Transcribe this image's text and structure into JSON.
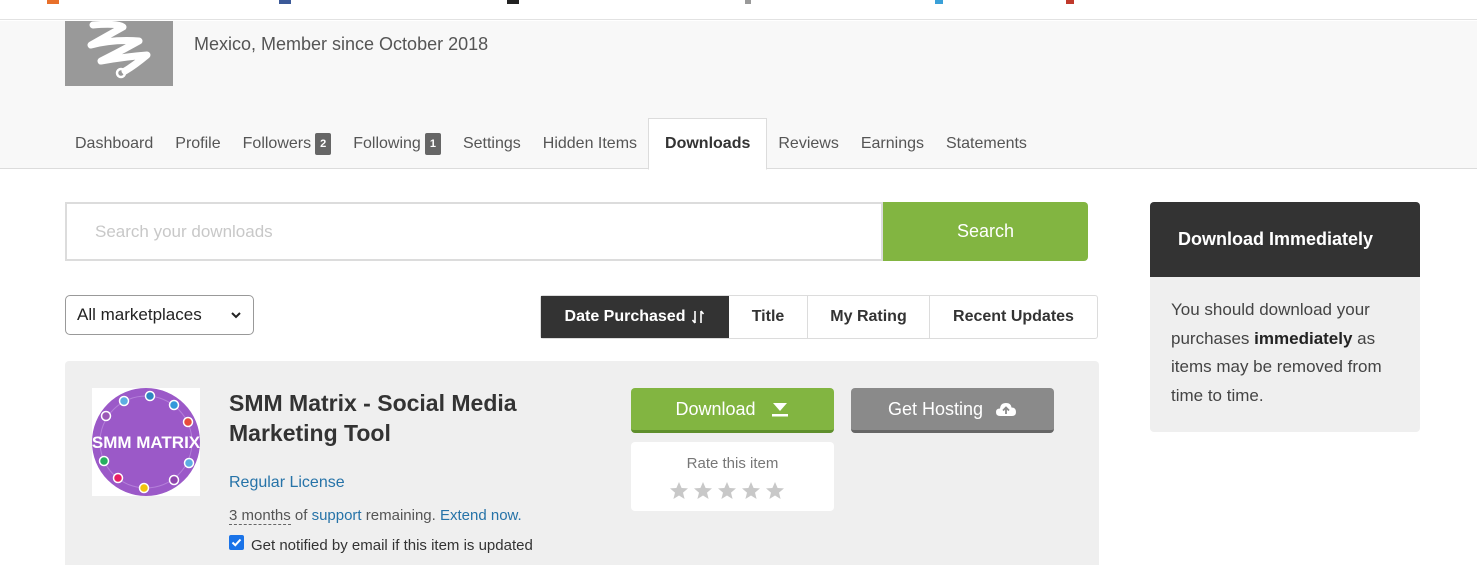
{
  "profile": {
    "location_line": "Mexico, Member since October 2018"
  },
  "tabs": [
    {
      "label": "Dashboard"
    },
    {
      "label": "Profile"
    },
    {
      "label": "Followers",
      "badge": "2"
    },
    {
      "label": "Following",
      "badge": "1"
    },
    {
      "label": "Settings"
    },
    {
      "label": "Hidden Items"
    },
    {
      "label": "Downloads",
      "active": true
    },
    {
      "label": "Reviews"
    },
    {
      "label": "Earnings"
    },
    {
      "label": "Statements"
    }
  ],
  "search": {
    "placeholder": "Search your downloads",
    "value": "",
    "button_label": "Search"
  },
  "filter": {
    "marketplace_selected": "All marketplaces"
  },
  "sort": {
    "options": [
      "Date Purchased",
      "Title",
      "My Rating",
      "Recent Updates"
    ],
    "active": "Date Purchased"
  },
  "item": {
    "thumbnail_text": "SMM MATRIX",
    "title": "SMM Matrix - Social Media Marketing Tool",
    "license": "Regular License",
    "support_months": "3 months",
    "support_of": "of",
    "support_link": "support",
    "support_remaining": "remaining.",
    "extend_link": "Extend now.",
    "notify_label": "Get notified by email if this item is updated",
    "notify_checked": true,
    "download_label": "Download",
    "hosting_label": "Get Hosting",
    "rate_label": "Rate this item",
    "rating": 0,
    "rating_max": 5
  },
  "side_panel": {
    "title": "Download Immediately",
    "text_before": "You should download your purchases",
    "text_bold": "immediately",
    "text_after": "as items may be removed from time to time."
  },
  "colors": {
    "accent_green": "#82b541",
    "dark": "#333333",
    "link_blue": "#2673a8",
    "hosting_gray": "#8a8a8a"
  }
}
